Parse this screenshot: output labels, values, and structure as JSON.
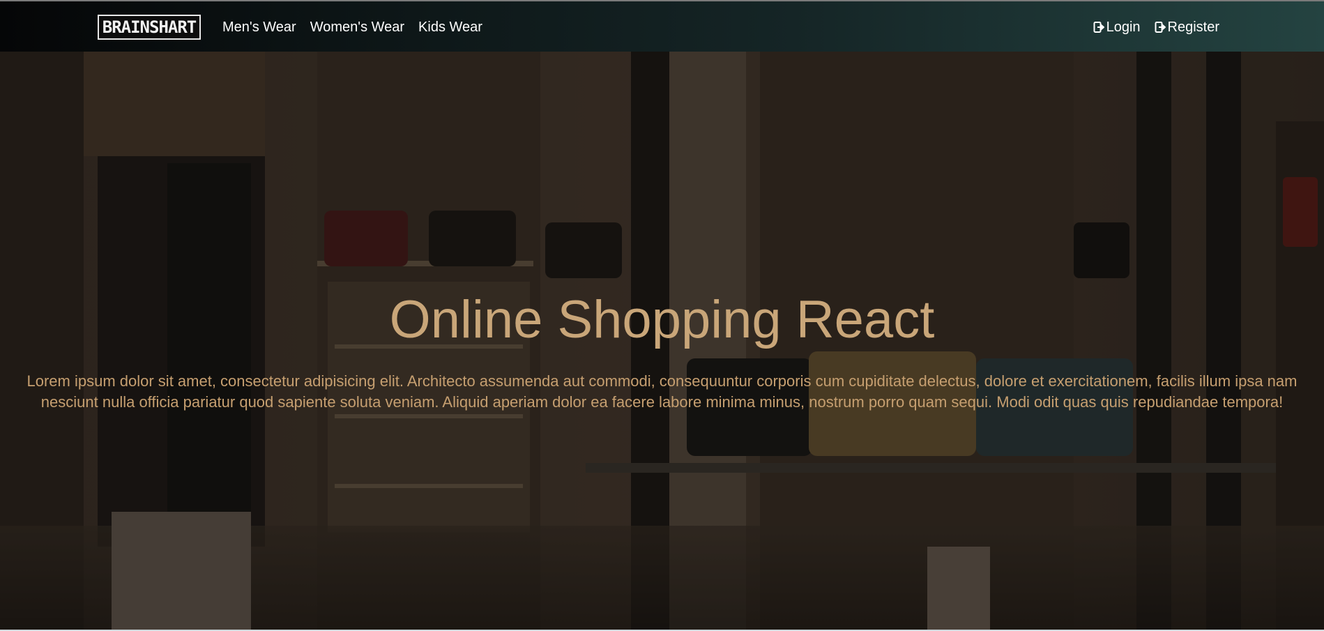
{
  "navbar": {
    "brand": "BRAINSHART",
    "links": [
      {
        "label": "Men's Wear"
      },
      {
        "label": "Women's Wear"
      },
      {
        "label": "Kids Wear"
      }
    ],
    "auth": {
      "login": {
        "label": "Login",
        "icon": "sign-in-icon"
      },
      "register": {
        "label": "Register",
        "icon": "sign-in-icon"
      }
    }
  },
  "hero": {
    "title": "Online Shopping React",
    "text": "Lorem ipsum dolor sit amet, consectetur adipisicing elit. Architecto assumenda aut commodi, consequuntur corporis cum cupiditate delectus, dolore et exercitationem, facilis illum ipsa nam nesciunt nulla officia pariatur quod sapiente soluta veniam. Aliquid aperiam dolor ea facere labore minima minus, nostrum porro quam sequi. Modi odit quas quis repudiandae tempora!"
  },
  "colors": {
    "hero_text": "#c69f70",
    "navbar_dark": "#050607",
    "navbar_teal": "#244341"
  }
}
